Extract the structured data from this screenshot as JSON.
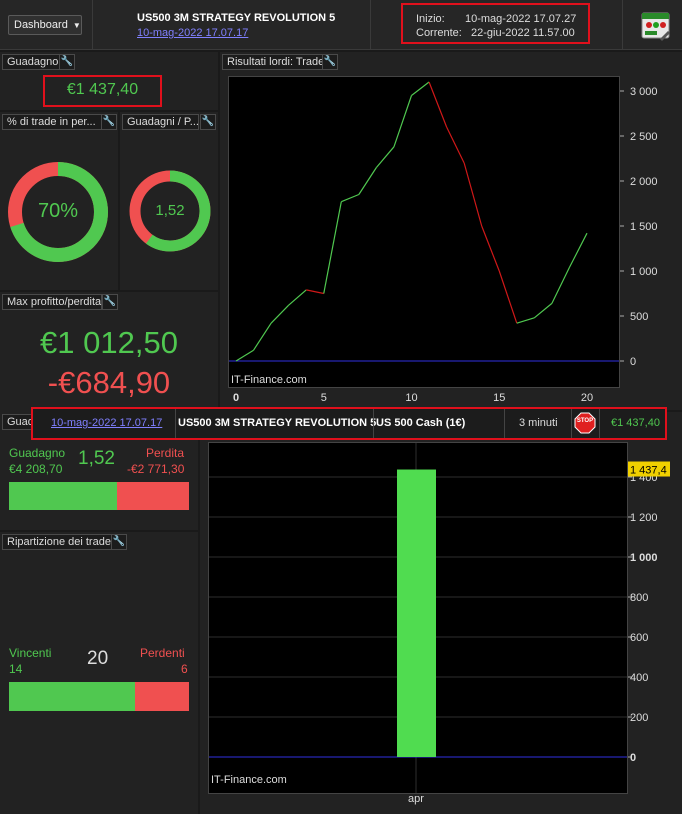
{
  "header": {
    "dashboard_label": "Dashboard",
    "strategy_name": "US500 3M STRATEGY REVOLUTION 5",
    "strategy_date": "10-mag-2022 17.07.17",
    "start_label": "Inizio:",
    "start_value": "10-mag-2022 17.07.27",
    "current_label": "Corrente:",
    "current_value": "22-giu-2022 11.57.00"
  },
  "gain_panel": {
    "title": "Guadagno",
    "value": "€1 437,40"
  },
  "pct_panel": {
    "title": "% di trade in per...",
    "value": "70%",
    "fraction": 0.7
  },
  "ratio_panel": {
    "title": "Guadagni / P...",
    "value": "1,52",
    "fraction": 0.6
  },
  "maxpl_panel": {
    "title": "Max profitto/perdita",
    "max_profit": "€1 012,50",
    "max_loss": "-€684,90"
  },
  "gross_panel": {
    "title": "Risultati lordi: Trade",
    "watermark": "IT-Finance.com"
  },
  "gl_panel": {
    "title": "Guadag",
    "gain_label": "Guadagno",
    "gain_value": "€4 208,70",
    "ratio": "1,52",
    "loss_label": "Perdita",
    "loss_value": "-€2 771,30",
    "gain_fraction": 0.6
  },
  "breakdown_panel": {
    "title": "Ripartizione dei trade",
    "win_label": "Vincenti",
    "win_count": "14",
    "total": "20",
    "lose_label": "Perdenti",
    "lose_count": "6",
    "win_fraction": 0.7
  },
  "info_bar": {
    "date": "10-mag-2022 17.07.17",
    "name": "US500 3M STRATEGY REVOLUTION 5",
    "instrument": "US 500 Cash (1€)",
    "timeframe": "3 minuti",
    "stop_label": "STOP",
    "gain": "€1 437,40"
  },
  "chart_data": [
    {
      "type": "line",
      "title": "Risultati lordi: Trade",
      "x": [
        0,
        1,
        2,
        3,
        4,
        5,
        6,
        7,
        8,
        9,
        10,
        11,
        12,
        13,
        14,
        15,
        16,
        17,
        18,
        19,
        20
      ],
      "values": [
        0,
        120,
        420,
        620,
        790,
        750,
        1770,
        1850,
        2150,
        2380,
        2950,
        3100,
        2600,
        2200,
        1500,
        1000,
        420,
        480,
        640,
        1040,
        1420
      ],
      "xticks": [
        "0",
        "5",
        "10",
        "15",
        "20"
      ],
      "yticks": [
        "0",
        "500",
        "1 000",
        "1 500",
        "2 000",
        "2 500",
        "3 000"
      ],
      "xlim": [
        0,
        20
      ],
      "ylim": [
        0,
        3300
      ],
      "up_color": "#50c850",
      "down_color": "#d01818",
      "zero_color": "#3030e0"
    },
    {
      "type": "bar",
      "categories": [
        "apr"
      ],
      "values": [
        1437.4
      ],
      "last_value_label": "1 437,4",
      "yticks": [
        "0",
        "200",
        "400",
        "600",
        "800",
        "1 000",
        "1 200",
        "1 400"
      ],
      "ylim": [
        0,
        1500
      ],
      "bar_color": "#50dc50",
      "zero_color": "#3030e0",
      "label_color": "#f0d000"
    }
  ]
}
